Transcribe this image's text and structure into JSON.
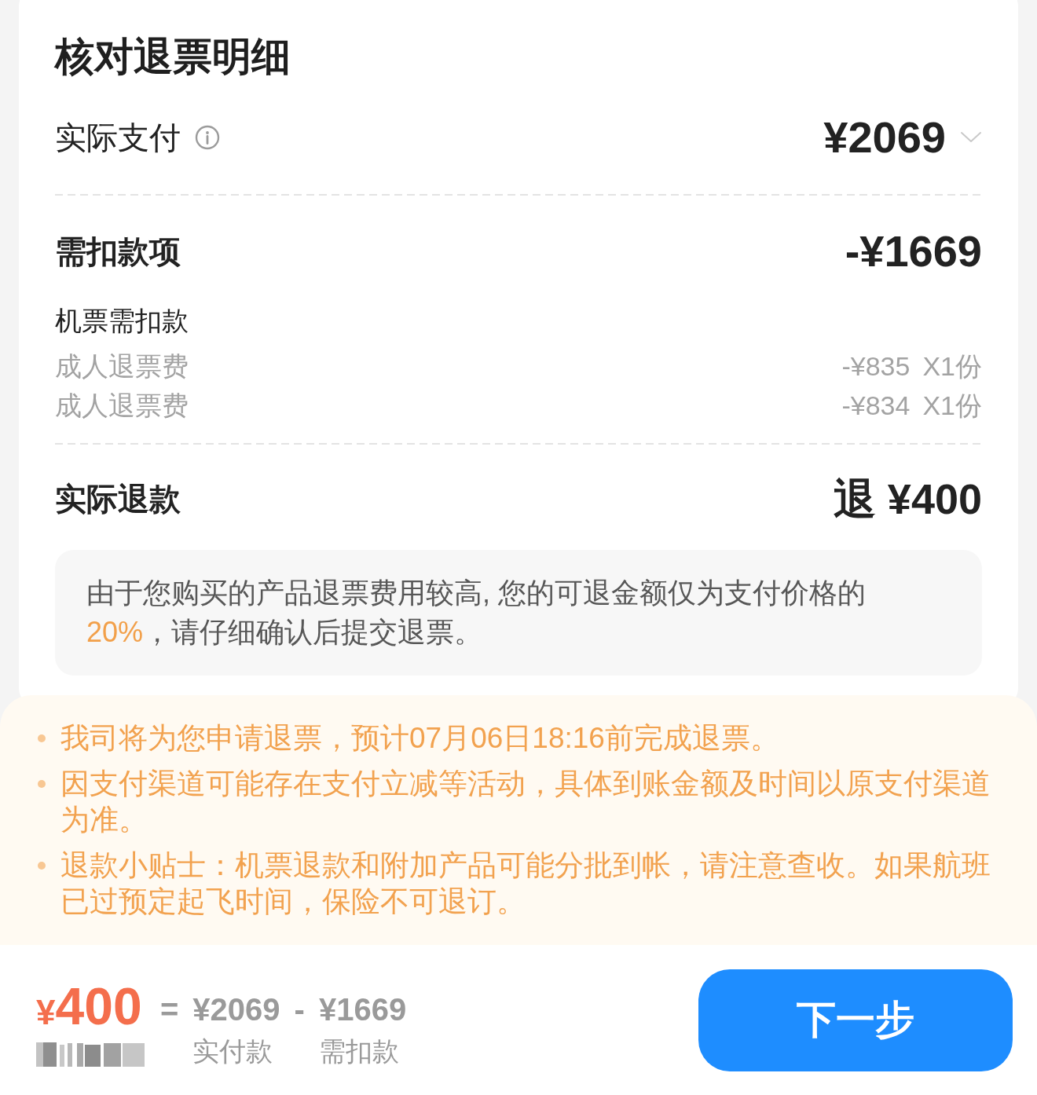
{
  "header": {
    "title": "核对退票明细"
  },
  "paid": {
    "label": "实际支付",
    "amount": "¥2069",
    "expanded": false
  },
  "deductions": {
    "label": "需扣款项",
    "amount": "-¥1669",
    "group": {
      "label": "机票需扣款",
      "items": [
        {
          "name": "成人退票费",
          "amount": "-¥835",
          "quantity": "X1份"
        },
        {
          "name": "成人退票费",
          "amount": "-¥834",
          "quantity": "X1份"
        }
      ]
    }
  },
  "refund": {
    "label": "实际退款",
    "amount": "退 ¥400"
  },
  "warning": {
    "segments": [
      {
        "text": "由于您购买的产品退票费用较高, 您的可退金额仅为支付价格的",
        "highlight": false
      },
      {
        "text": "20%",
        "highlight": true
      },
      {
        "text": "，请仔细确认后提交退票。",
        "highlight": false
      }
    ]
  },
  "tips": [
    "我司将为您申请退票，预计07月06日18:16前完成退票。",
    "因支付渠道可能存在支付立减等活动，具体到账金额及时间以原支付渠道为准。",
    "退款小贴士：机票退款和附加产品可能分批到帐，请注意查收。如果航班已过预定起飞时间，保险不可退订。"
  ],
  "footer": {
    "total": {
      "currency": "¥",
      "value": "400"
    },
    "terms": [
      {
        "operator": "=",
        "amount": "¥2069",
        "label": "实付款"
      },
      {
        "operator": "-",
        "amount": "¥1669",
        "label": "需扣款"
      }
    ],
    "next_button": "下一步"
  }
}
